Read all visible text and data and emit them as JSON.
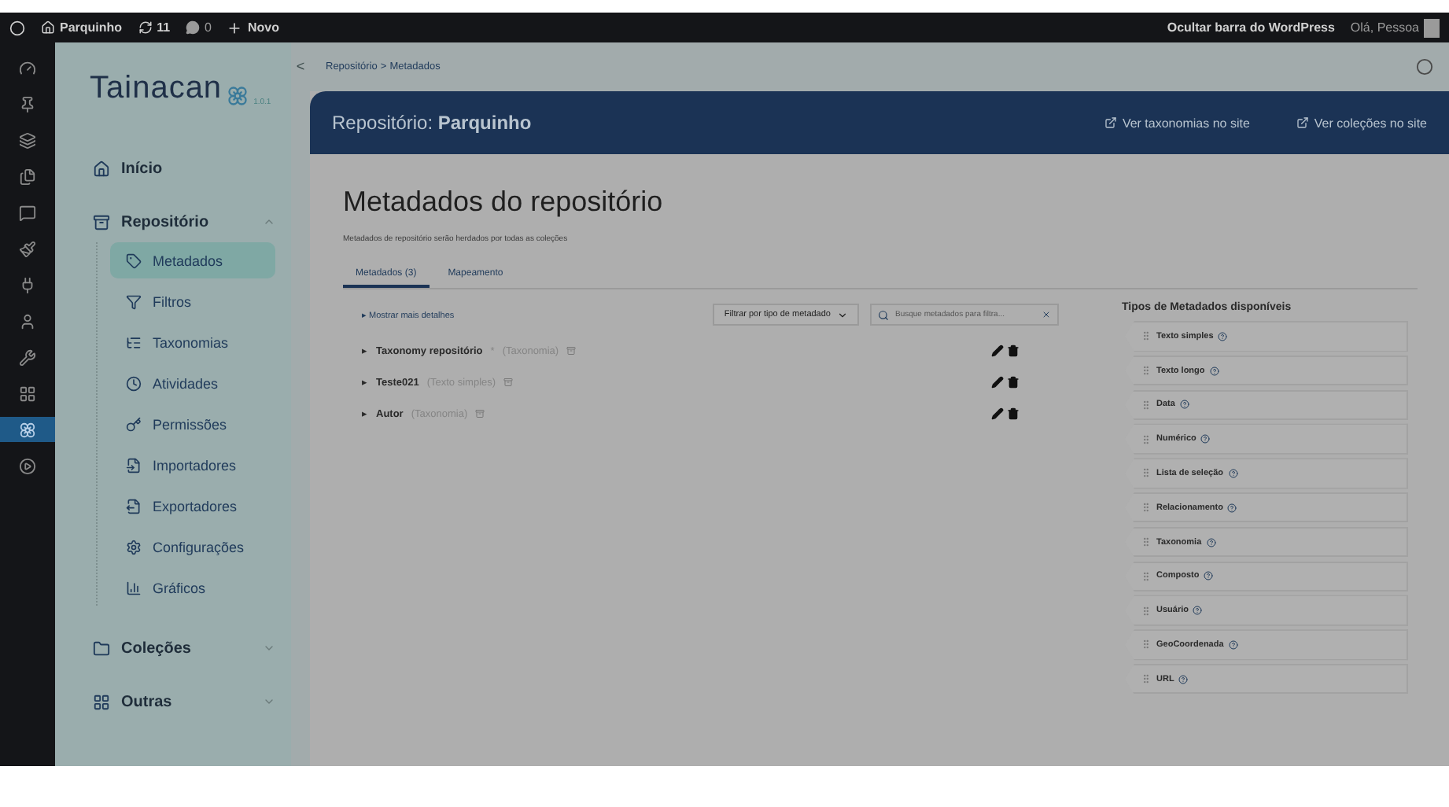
{
  "admin_bar": {
    "site": "Parquinho",
    "updates": "11",
    "comments": "0",
    "new": "Novo",
    "hide_bar": "Ocultar barra do WordPress",
    "greeting": "Olá, Pessoa"
  },
  "wp_menu": [
    {
      "selected": false
    },
    {
      "selected": false
    },
    {
      "selected": false
    },
    {
      "selected": false
    },
    {
      "selected": false
    },
    {
      "selected": false
    },
    {
      "selected": false
    },
    {
      "selected": false
    },
    {
      "selected": false
    },
    {
      "selected": false
    },
    {
      "selected": true
    },
    {
      "selected": false
    }
  ],
  "sidebar": {
    "logo": "Tainacan",
    "version": "1.0.1",
    "collapse": "<",
    "items": [
      {
        "label": "Início"
      },
      {
        "label": "Repositório",
        "expanded": true,
        "children": [
          {
            "label": "Metadados",
            "selected": true
          },
          {
            "label": "Filtros",
            "selected": false
          },
          {
            "label": "Taxonomias",
            "selected": false
          },
          {
            "label": "Atividades",
            "selected": false
          },
          {
            "label": "Permissões",
            "selected": false
          },
          {
            "label": "Importadores",
            "selected": false
          },
          {
            "label": "Exportadores",
            "selected": false
          },
          {
            "label": "Configurações",
            "selected": false
          },
          {
            "label": "Gráficos",
            "selected": false
          }
        ]
      },
      {
        "label": "Coleções",
        "expanded": false
      },
      {
        "label": "Outras",
        "expanded": false
      }
    ]
  },
  "breadcrumb": {
    "items": [
      "Repositório",
      "Metadados"
    ],
    "separator": ">"
  },
  "header": {
    "title": "Repositório: **Parquinho**",
    "links": [
      "Ver taxonomias no site",
      "Ver coleções no site"
    ]
  },
  "page": {
    "title": "Metadados do repositório",
    "description": "Metadados de repositório serão herdados por todas as coleções",
    "tabs": [
      {
        "label": "Metadados (3)",
        "selected": true
      },
      {
        "label": "Mapeamento",
        "selected": false
      }
    ],
    "expander": "▸",
    "required_mark": "*",
    "show_more": "Mostrar mais detalhes",
    "filter_button": "Filtrar por tipo de metadado",
    "search": {
      "placeholder": "Busque metadados para filtra..."
    },
    "metadata": [
      {
        "name": "Taxonomy repositório",
        "required": true,
        "type": "(Taxonomia)"
      },
      {
        "name": "Teste021",
        "required": false,
        "type": "(Texto simples)"
      },
      {
        "name": "Autor",
        "required": false,
        "type": "(Taxonomia)"
      }
    ],
    "types_title": "Tipos de Metadados disponíveis",
    "types": [
      "Texto simples",
      "Texto longo",
      "Data",
      "Numérico",
      "Lista de seleção",
      "Relacionamento",
      "Taxonomia",
      "Composto",
      "Usuário",
      "GeoCoordenada",
      "URL"
    ]
  }
}
